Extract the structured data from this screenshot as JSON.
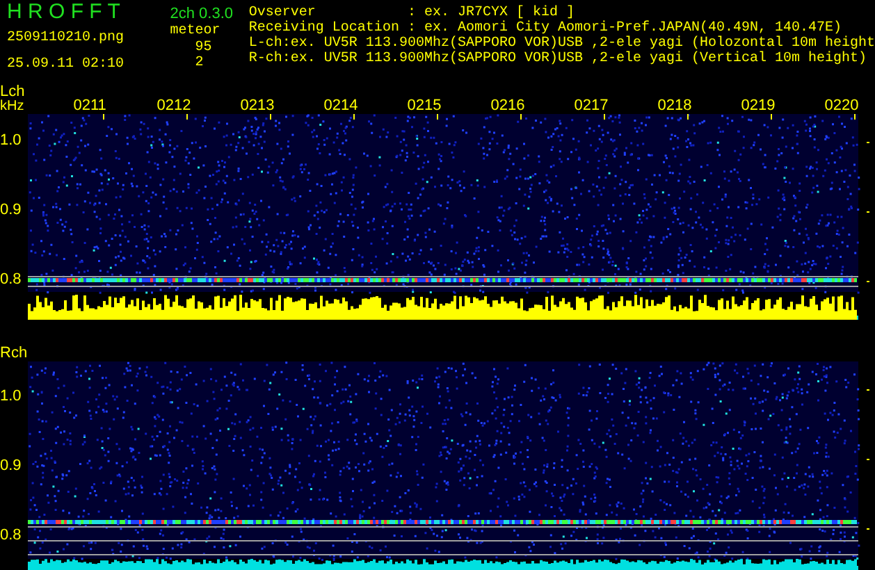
{
  "app": {
    "title": "H R O F F T",
    "version": "2ch 0.3.0",
    "file": "2509110210.png",
    "datetime": "25.09.11 02:10",
    "count_label": "meteor"
  },
  "info": [
    "Ovserver           : ex. JR7CYX [ kid ]",
    "Receiving Location : ex. Aomori City Aomori-Pref.JAPAN(40.49N, 140.47E)",
    "L-ch:ex. UV5R 113.900Mhz(SAPPORO VOR)USB ,2-ele yagi (Holozontal 10m height",
    "R-ch:ex. UV5R 113.900Mhz(SAPPORO VOR)USB ,2-ele yagi (Vertical 10m height)"
  ],
  "time_axis": [
    "0211",
    "0212",
    "0213",
    "0214",
    "0215",
    "0216",
    "0217",
    "0218",
    "0219",
    "0220"
  ],
  "channels": [
    {
      "label": "Lch",
      "unit": "kHz",
      "count": "95",
      "y_ticks": [
        "1.0",
        "0.9",
        "0.8"
      ]
    },
    {
      "label": "Rch",
      "count": "2",
      "y_ticks": [
        "1.0",
        "0.9",
        "0.8"
      ]
    }
  ]
}
